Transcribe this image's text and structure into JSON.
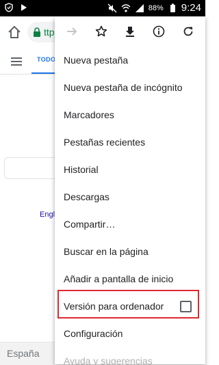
{
  "statusbar": {
    "battery_pct": "88%",
    "time": "9:24"
  },
  "toolbar": {
    "url_partial": "ttp"
  },
  "page": {
    "tab_todo": "TODO",
    "link_partial": "Engl",
    "footer_country": "España"
  },
  "menu": {
    "icons": [
      "forward-icon",
      "star-icon",
      "download-icon",
      "info-icon",
      "refresh-icon"
    ],
    "items": [
      "Nueva pestaña",
      "Nueva pestaña de incógnito",
      "Marcadores",
      "Pestañas recientes",
      "Historial",
      "Descargas",
      "Compartir…",
      "Buscar en la página",
      "Añadir a pantalla de inicio",
      "Versión para ordenador",
      "Configuración",
      "Ayuda y sugerencias"
    ],
    "desktop_checked": false
  },
  "colors": {
    "accent": "#1a73e8",
    "highlight": "#e0262f",
    "secure": "#0b8043"
  }
}
